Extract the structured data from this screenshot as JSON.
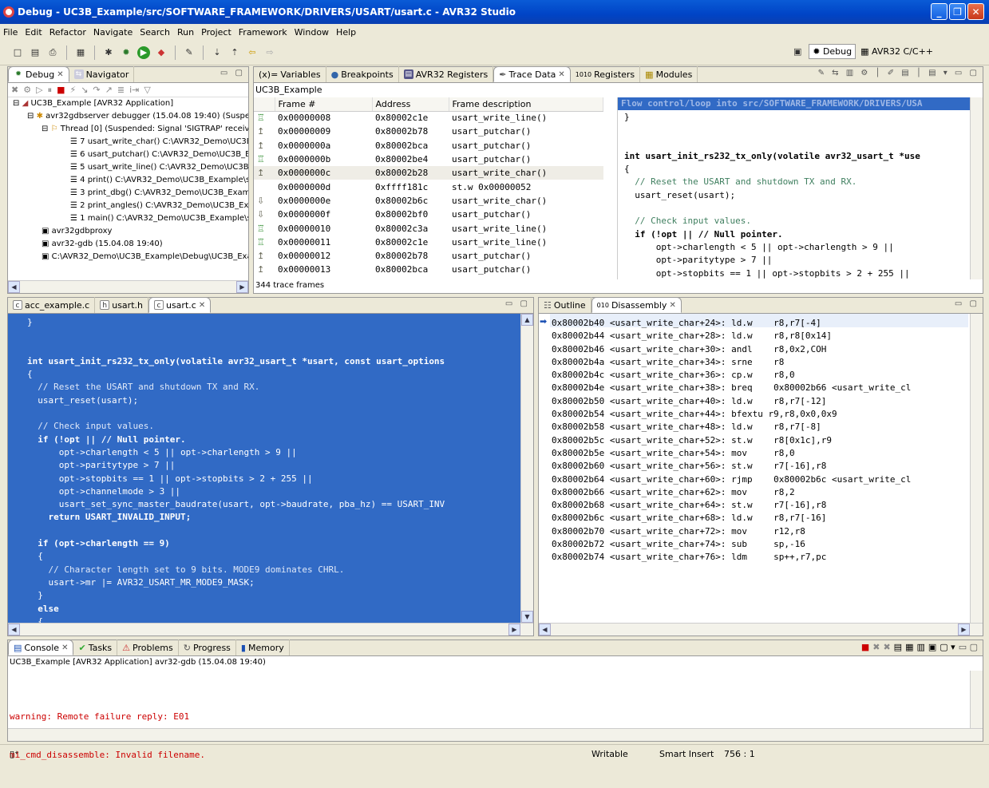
{
  "window": {
    "title": "Debug - UC3B_Example/src/SOFTWARE_FRAMEWORK/DRIVERS/USART/usart.c - AVR32 Studio"
  },
  "menu": [
    "File",
    "Edit",
    "Refactor",
    "Navigate",
    "Search",
    "Run",
    "Project",
    "Framework",
    "Window",
    "Help"
  ],
  "perspectives": {
    "debug": "Debug",
    "cpp": "AVR32 C/C++"
  },
  "debug_view": {
    "tabs": {
      "debug": "Debug",
      "navigator": "Navigator"
    },
    "tree": [
      "UC3B_Example [AVR32 Application]",
      "avr32gdbserver debugger (15.04.08 19:40) (Suspen",
      "Thread [0] (Suspended: Signal 'SIGTRAP' receive",
      "7 usart_write_char() C:\\AVR32_Demo\\UC3B",
      "6 usart_putchar() C:\\AVR32_Demo\\UC3B_Ex",
      "5 usart_write_line() C:\\AVR32_Demo\\UC3B_",
      "4 print() C:\\AVR32_Demo\\UC3B_Example\\sr",
      "3 print_dbg() C:\\AVR32_Demo\\UC3B_Examp",
      "2 print_angles() C:\\AVR32_Demo\\UC3B_Exa",
      "1 main() C:\\AVR32_Demo\\UC3B_Example\\sr",
      "avr32gdbproxy",
      "avr32-gdb (15.04.08 19:40)",
      "C:\\AVR32_Demo\\UC3B_Example\\Debug\\UC3B_Exam"
    ]
  },
  "trace_view": {
    "tabs": {
      "variables": "Variables",
      "breakpoints": "Breakpoints",
      "avr32_registers": "AVR32 Registers",
      "trace_data": "Trace Data",
      "registers": "Registers",
      "modules": "Modules"
    },
    "project": "UC3B_Example",
    "columns": [
      "Frame #",
      "Address",
      "Frame description"
    ],
    "rows": [
      [
        "0x00000008",
        "0x80002c1e",
        "usart_write_line()"
      ],
      [
        "0x00000009",
        "0x80002b78",
        "usart_putchar()"
      ],
      [
        "0x0000000a",
        "0x80002bca",
        "usart_putchar()"
      ],
      [
        "0x0000000b",
        "0x80002be4",
        "usart_putchar()"
      ],
      [
        "0x0000000c",
        "0x80002b28",
        "usart_write_char()"
      ],
      [
        "0x0000000d",
        "0xffff181c",
        "st.w 0x00000052"
      ],
      [
        "0x0000000e",
        "0x80002b6c",
        "usart_write_char()"
      ],
      [
        "0x0000000f",
        "0x80002bf0",
        "usart_putchar()"
      ],
      [
        "0x00000010",
        "0x80002c3a",
        "usart_write_line()"
      ],
      [
        "0x00000011",
        "0x80002c1e",
        "usart_write_line()"
      ],
      [
        "0x00000012",
        "0x80002b78",
        "usart_putchar()"
      ],
      [
        "0x00000013",
        "0x80002bca",
        "usart_putchar()"
      ]
    ],
    "footer": "344 trace frames",
    "detail_header": "Flow control/loop into src/SOFTWARE_FRAMEWORK/DRIVERS/USA",
    "detail_code": [
      "}",
      "",
      "",
      "int usart_init_rs232_tx_only(volatile avr32_usart_t *use",
      "{",
      "  // Reset the USART and shutdown TX and RX.",
      "  usart_reset(usart);",
      "",
      "  // Check input values.",
      "  if (!opt || // Null pointer.",
      "      opt->charlength < 5 || opt->charlength > 9 ||",
      "      opt->paritytype > 7 ||",
      "      opt->stopbits == 1 || opt->stopbits > 2 + 255 ||"
    ]
  },
  "editor": {
    "tabs": [
      "acc_example.c",
      "usart.h",
      "usart.c"
    ],
    "lines": [
      "}",
      "",
      "",
      "int usart_init_rs232_tx_only(volatile avr32_usart_t *usart, const usart_options",
      "{",
      "  // Reset the USART and shutdown TX and RX.",
      "  usart_reset(usart);",
      "",
      "  // Check input values.",
      "  if (!opt || // Null pointer.",
      "      opt->charlength < 5 || opt->charlength > 9 ||",
      "      opt->paritytype > 7 ||",
      "      opt->stopbits == 1 || opt->stopbits > 2 + 255 ||",
      "      opt->channelmode > 3 ||",
      "      usart_set_sync_master_baudrate(usart, opt->baudrate, pba_hz) == USART_INV",
      "    return USART_INVALID_INPUT;",
      "",
      "  if (opt->charlength == 9)",
      "  {",
      "    // Character length set to 9 bits. MODE9 dominates CHRL.",
      "    usart->mr |= AVR32_USART_MR_MODE9_MASK;",
      "  }",
      "  else",
      "  {"
    ]
  },
  "disasm": {
    "tabs": {
      "outline": "Outline",
      "disassembly": "Disassembly"
    },
    "lines": [
      "0x80002b40 <usart_write_char+24>: ld.w    r8,r7[-4]",
      "0x80002b44 <usart_write_char+28>: ld.w    r8,r8[0x14]",
      "0x80002b46 <usart_write_char+30>: andl    r8,0x2,COH",
      "0x80002b4a <usart_write_char+34>: srne    r8",
      "0x80002b4c <usart_write_char+36>: cp.w    r8,0",
      "0x80002b4e <usart_write_char+38>: breq    0x80002b66 <usart_write_cl",
      "0x80002b50 <usart_write_char+40>: ld.w    r8,r7[-12]",
      "0x80002b54 <usart_write_char+44>: bfextu r9,r8,0x0,0x9",
      "0x80002b58 <usart_write_char+48>: ld.w    r8,r7[-8]",
      "0x80002b5c <usart_write_char+52>: st.w    r8[0x1c],r9",
      "0x80002b5e <usart_write_char+54>: mov     r8,0",
      "0x80002b60 <usart_write_char+56>: st.w    r7[-16],r8",
      "0x80002b64 <usart_write_char+60>: rjmp    0x80002b6c <usart_write_cl",
      "0x80002b66 <usart_write_char+62>: mov     r8,2",
      "0x80002b68 <usart_write_char+64>: st.w    r7[-16],r8",
      "0x80002b6c <usart_write_char+68>: ld.w    r8,r7[-16]",
      "0x80002b70 <usart_write_char+72>: mov     r12,r8",
      "0x80002b72 <usart_write_char+74>: sub     sp,-16",
      "0x80002b74 <usart_write_char+76>: ldm     sp++,r7,pc"
    ]
  },
  "console": {
    "tabs": {
      "console": "Console",
      "tasks": "Tasks",
      "problems": "Problems",
      "progress": "Progress",
      "memory": "Memory"
    },
    "process": "UC3B_Example [AVR32 Application] avr32-gdb (15.04.08 19:40)",
    "lines": [
      "warning: Remote failure reply: E01",
      "mi_cmd_disassemble: Invalid filename."
    ]
  },
  "status": {
    "mode": "Writable",
    "insert": "Smart Insert",
    "position": "756 : 1"
  },
  "colors": {
    "selection": "#316ac5",
    "error": "#cc0000",
    "titlebar": "#0a5bd6"
  }
}
